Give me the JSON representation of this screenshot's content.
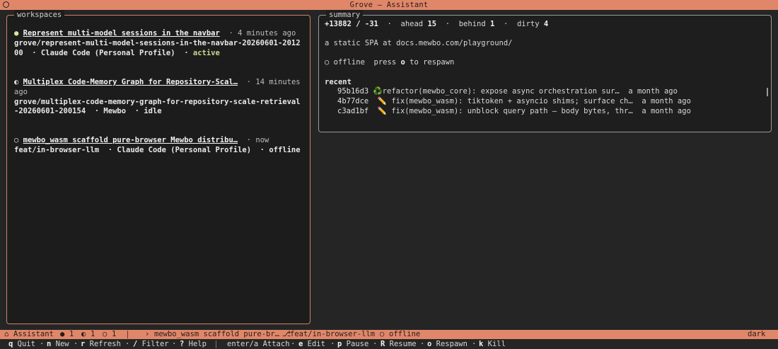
{
  "window": {
    "title": "Grove — Assistant"
  },
  "workspaces": {
    "legend": "workspaces",
    "items": [
      {
        "indicator": "●",
        "title": "Represent multi-model sessions in the navbar",
        "time": "· 4 minutes ago",
        "line2": "grove/represent-multi-model-sessions-in-the-navbar-20260601-2012",
        "line3_a": "00  · Claude Code (Personal Profile)  · ",
        "status": "active"
      },
      {
        "indicator": "◐",
        "title": "Multiplex Code-Memory Graph for Repository-Scal…",
        "time": "· 14 minutes",
        "line2": "ago",
        "line3_a": "grove/multiplex-code-memory-graph-for-repository-scale-retrieval",
        "line4": "-20260601-200154  · Mewbo  · idle"
      },
      {
        "indicator": "○",
        "title": "mewbo_wasm scaffold pure-browser Mewbo distribu…",
        "time": "· now",
        "line2": "feat/in-browser-llm  · Claude Code (Personal Profile)  · offline"
      }
    ]
  },
  "summary": {
    "legend": "summary",
    "stats": {
      "diff": "+13882 / -31",
      "ahead_label": "ahead",
      "ahead": "15",
      "behind_label": "behind",
      "behind": "1",
      "dirty_label": "dirty",
      "dirty": "4",
      "dot": "·"
    },
    "description": "a static SPA at docs.mewbo.com/playground/",
    "offline_icon": "○",
    "offline_pre": " offline  press ",
    "offline_key": "o",
    "offline_post": " to respawn",
    "recent_label": "recent",
    "commits": [
      {
        "sha": "95b16d3",
        "icon": "♻️",
        "icon_name": "recycle-icon",
        "msg": "refactor(mewbo_core): expose async orchestration sur…",
        "when": "a month ago"
      },
      {
        "sha": "4b77dce",
        "icon": "✏️",
        "icon_name": "pencil-icon",
        "msg": "fix(mewbo_wasm): tiktoken + asyncio shims; surface ch…",
        "when": "a month ago"
      },
      {
        "sha": "c3ad1bf",
        "icon": "✏️",
        "icon_name": "pencil-icon",
        "msg": "fix(mewbo_wasm): unblock query path — body bytes, thr…",
        "when": "a month ago"
      }
    ]
  },
  "statusbar": {
    "home_icon": "⌂",
    "app": "Assistant",
    "count_active_icon": "●",
    "count_active": "1",
    "count_idle_icon": "◐",
    "count_idle": "1",
    "count_offline_icon": "○",
    "count_offline": "1",
    "current_icon": "›",
    "current": "mewbo_wasm scaffold pure-br…",
    "branch_icon": "⎇",
    "branch": "feat/in-browser-llm",
    "state_icon": "○",
    "state": "offline",
    "theme": "dark"
  },
  "keys": [
    {
      "key": "q",
      "label": "Quit"
    },
    {
      "key": "n",
      "label": "New"
    },
    {
      "key": "r",
      "label": "Refresh"
    },
    {
      "key": "/",
      "label": "Filter"
    },
    {
      "key": "?",
      "label": "Help"
    },
    {
      "key": "enter/a",
      "label": "Attach"
    },
    {
      "key": "e",
      "label": "Edit"
    },
    {
      "key": "p",
      "label": "Pause"
    },
    {
      "key": "R",
      "label": "Resume"
    },
    {
      "key": "o",
      "label": "Respawn"
    },
    {
      "key": "k",
      "label": "Kill"
    }
  ],
  "colors": {
    "accent": "#e0876a",
    "active": "#c7d98a",
    "background": "#252525"
  }
}
